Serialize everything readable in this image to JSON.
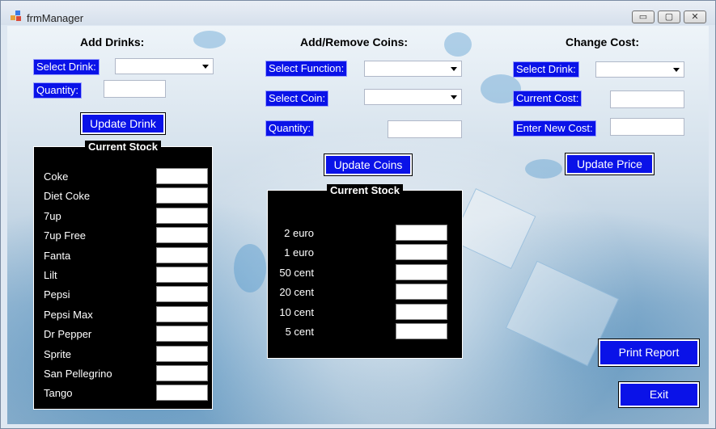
{
  "window": {
    "title": "frmManager",
    "minimize": "▭",
    "maximize": "▢",
    "close": "✕"
  },
  "add_drinks": {
    "heading": "Add Drinks:",
    "select_drink_label": "Select Drink:",
    "quantity_label": "Quantity:",
    "update_button": "Update Drink"
  },
  "coins": {
    "heading": "Add/Remove Coins:",
    "select_function_label": "Select Function:",
    "select_coin_label": "Select Coin:",
    "quantity_label": "Quantity:",
    "update_button": "Update Coins"
  },
  "change_cost": {
    "heading": "Change Cost:",
    "select_drink_label": "Select Drink:",
    "current_cost_label": "Current Cost:",
    "new_cost_label": "Enter New Cost:",
    "update_button": "Update Price"
  },
  "drink_stock": {
    "title": "Current Stock",
    "items": [
      "Coke",
      "Diet Coke",
      "7up",
      "7up Free",
      "Fanta",
      "Lilt",
      "Pepsi",
      "Pepsi Max",
      "Dr Pepper",
      "Sprite",
      "San Pellegrino",
      "Tango"
    ]
  },
  "coin_stock": {
    "title": "Current Stock",
    "items": [
      "2 euro",
      "1 euro",
      "50 cent",
      "20 cent",
      "10 cent",
      "5 cent"
    ]
  },
  "actions": {
    "print_report": "Print Report",
    "exit": "Exit"
  },
  "colors": {
    "label_bg": "#0a12e8",
    "panel_bg": "#000000"
  }
}
